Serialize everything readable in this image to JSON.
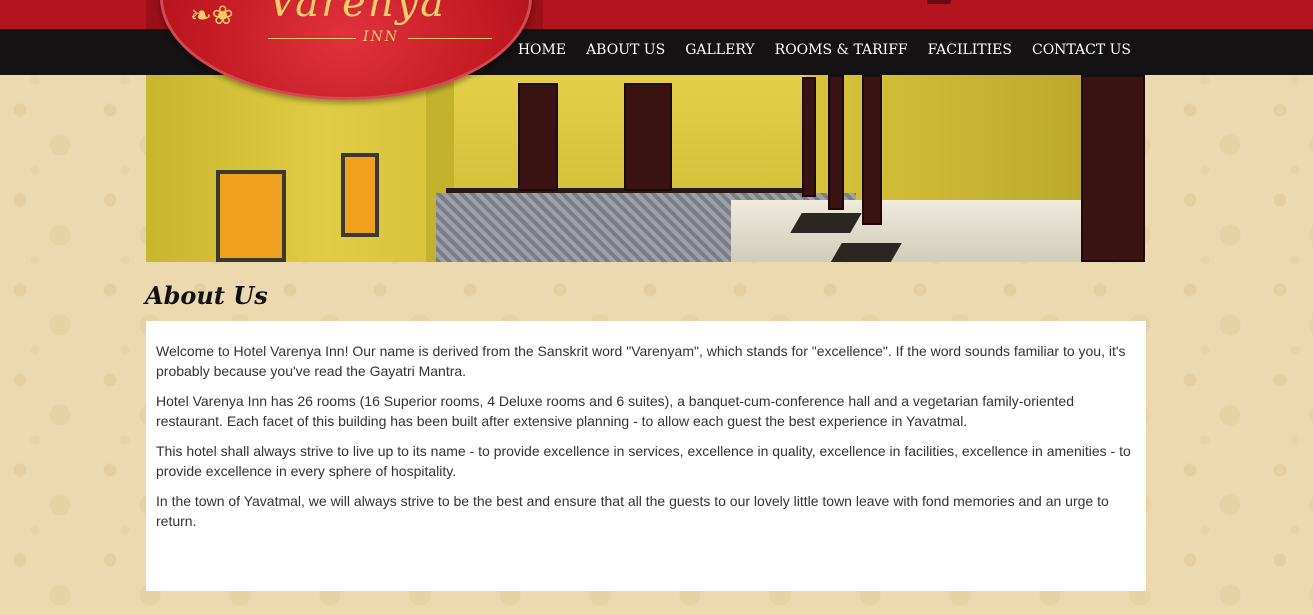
{
  "brand": {
    "name": "Varenya",
    "sub": "INN",
    "colors": {
      "header_red": "#b3141f",
      "nav_black": "#141212",
      "logo_gold": "#f2cf6a"
    }
  },
  "nav": {
    "items": [
      "HOME",
      "ABOUT US",
      "GALLERY",
      "ROOMS & TARIFF",
      "FACILITIES",
      "CONTACT US"
    ]
  },
  "banner": {
    "description_icon": "hotel-corridor-photo"
  },
  "about": {
    "title": "About Us",
    "paragraphs": [
      "Welcome to Hotel Varenya Inn! Our name is derived from the Sanskrit word \"Varenyam\", which stands for \"excellence\". If the word sounds familiar to you, it's probably because you've read the Gayatri Mantra.",
      "Hotel Varenya Inn has 26 rooms (16 Superior rooms, 4 Deluxe rooms and 6 suites), a banquet-cum-conference hall and a vegetarian family-oriented restaurant. Each facet of this building has been built after extensive planning - to allow each guest the best experience in Yavatmal.",
      "This hotel shall always strive to live up to its name - to provide excellence in services, excellence in quality, excellence in facilities, excellence in amenities - to provide excellence in every sphere of hospitality.",
      "In the town of Yavatmal, we will always strive to be the best and ensure that all the guests to our lovely little town leave with fond memories and an urge to return."
    ]
  }
}
